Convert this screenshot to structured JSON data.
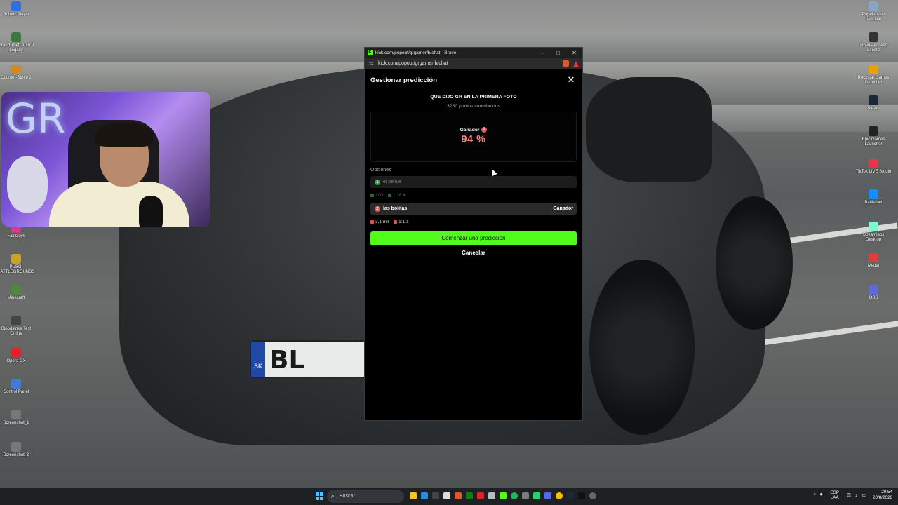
{
  "desktop": {
    "icons_left": [
      {
        "label": "Roblox Player",
        "color": "#2f6fe3"
      },
      {
        "label": "Grand Theft Auto V Legacy",
        "color": "#3c7a3c"
      },
      {
        "label": "Counter-Strike 2",
        "color": "#d08a1e"
      },
      {
        "label": "Fall Guys",
        "color": "#d43a8a"
      },
      {
        "label": "PUBG: BATTLEGROUNDS",
        "color": "#c9a227"
      },
      {
        "label": "Minecraft",
        "color": "#4d8a38"
      },
      {
        "label": "Bloodstrike Test Online",
        "color": "#444"
      },
      {
        "label": "Opera GX",
        "color": "#e0222b"
      },
      {
        "label": "Control Panel",
        "color": "#3b7dd8"
      },
      {
        "label": "Screenshot_1",
        "color": "#777"
      },
      {
        "label": "Screenshot_2",
        "color": "#777"
      }
    ],
    "icons_right": [
      {
        "label": "Papelera de reciclaje",
        "color": "#8aa4c8"
      },
      {
        "label": "Trovo - Acceso directo",
        "color": "#333"
      },
      {
        "label": "Rockstar Games Launcher",
        "color": "#e5a400"
      },
      {
        "label": "Steam",
        "color": "#1b2838"
      },
      {
        "label": "Epic Games Launcher",
        "color": "#222"
      },
      {
        "label": "TikTok LIVE Studio",
        "color": "#e8334a"
      },
      {
        "label": "Battle.net",
        "color": "#148eff"
      },
      {
        "label": "Streamlabs Desktop",
        "color": "#80f5d2"
      },
      {
        "label": "Medal",
        "color": "#e5393c"
      },
      {
        "label": "OBS",
        "color": "#5b6ad6"
      }
    ]
  },
  "browser": {
    "title": "kick.com/popout/grgamerfb/chat - Brave",
    "url": "kick.com/popout/grgamerfb/chat",
    "controls": {
      "minimize": "–",
      "maximize": "□",
      "close": "✕"
    }
  },
  "prediction": {
    "header": "Gestionar predicción",
    "close": "✕",
    "question": "QUE DIJO GR EN LA PRIMERA FOTO",
    "contributed": "3280 puntos contribuidos",
    "winner_label": "Ganador",
    "winner_number": "2",
    "winner_percent": "94 %",
    "options_label": "Opciones",
    "options": [
      {
        "number": "1",
        "name": "el pelaje",
        "tag": "",
        "points": "200",
        "ratio": "1:16.4",
        "is_winner": false
      },
      {
        "number": "2",
        "name": "las bolitas",
        "tag": "Ganador",
        "points": "3,1 mil",
        "ratio": "1:1.1",
        "is_winner": true
      }
    ],
    "start_button": "Comenzar una predicción",
    "cancel_button": "Cancelar"
  },
  "taskbar": {
    "search_placeholder": "Buscar",
    "lang_top": "ESP",
    "lang_bottom": "LAA",
    "time": "20:54",
    "date": "20/8/2026"
  },
  "colors": {
    "kick_green": "#53fc18",
    "winner_red": "#ff7f7f"
  }
}
